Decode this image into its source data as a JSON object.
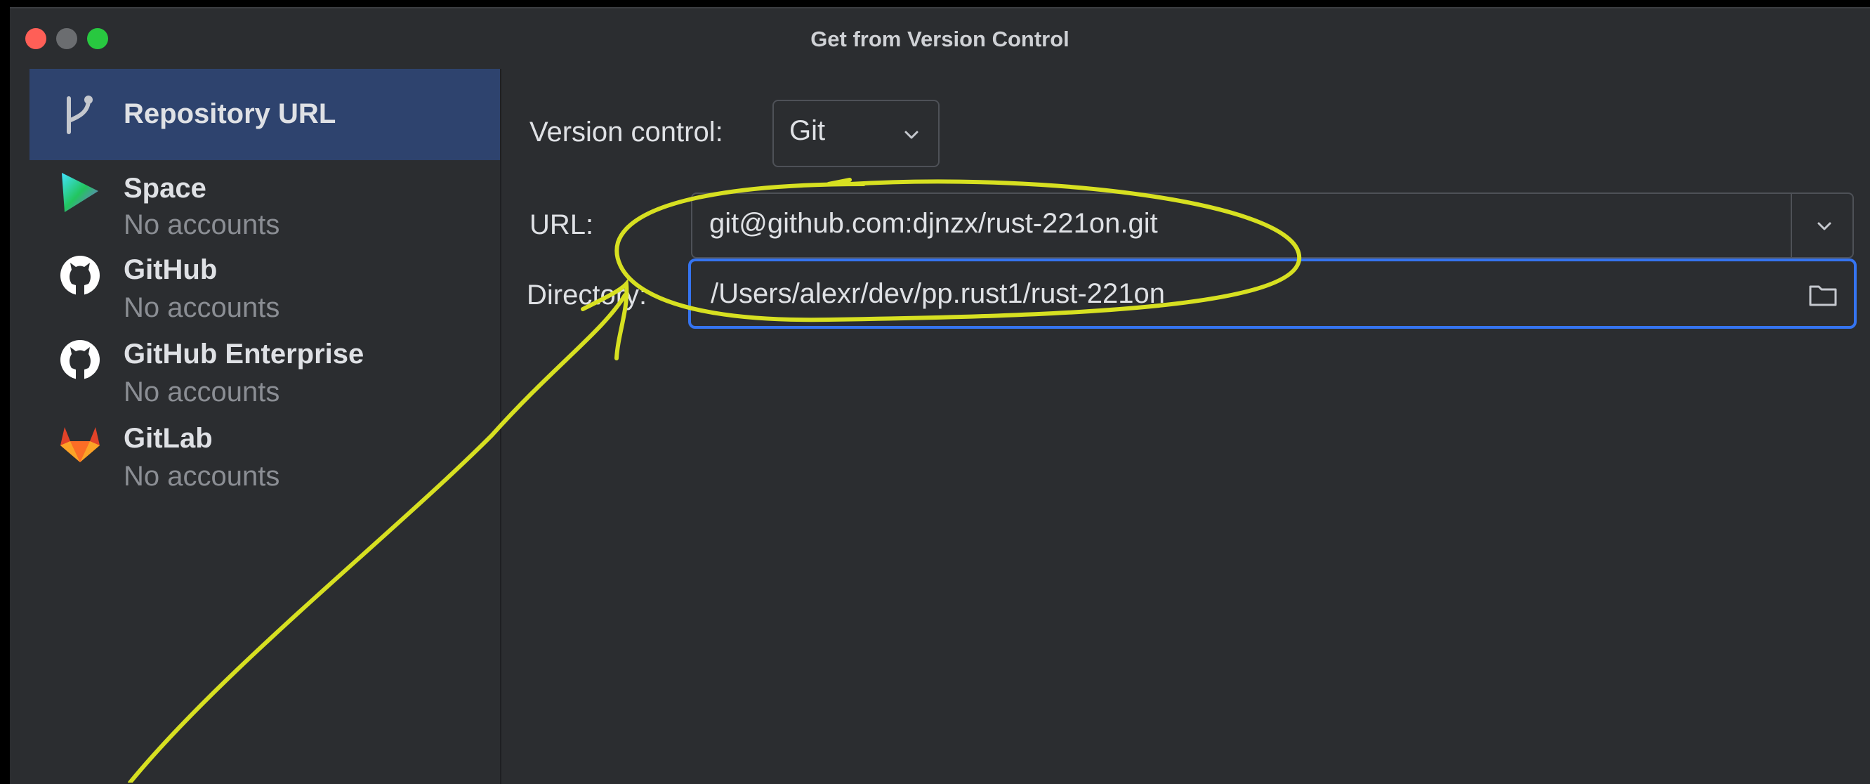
{
  "window": {
    "title": "Get from Version Control",
    "traffic_colors": [
      "#ff5f57",
      "#6b6d70",
      "#28c840"
    ]
  },
  "sidebar": {
    "items": [
      {
        "name": "Repository URL",
        "sub": "",
        "icon": "vcs-branch-icon",
        "selected": true
      },
      {
        "name": "Space",
        "sub": "No accounts",
        "icon": "space-logo-icon",
        "selected": false
      },
      {
        "name": "GitHub",
        "sub": "No accounts",
        "icon": "github-logo-icon",
        "selected": false
      },
      {
        "name": "GitHub Enterprise",
        "sub": "No accounts",
        "icon": "github-logo-icon",
        "selected": false
      },
      {
        "name": "GitLab",
        "sub": "No accounts",
        "icon": "gitlab-logo-icon",
        "selected": false
      }
    ]
  },
  "form": {
    "version_control_label": "Version control:",
    "version_control_value": "Git",
    "url_label": "URL:",
    "url_value": "git@github.com:djnzx/rust-221on.git",
    "directory_label": "Directory:",
    "directory_value": "/Users/alexr/dev/pp.rust1/rust-221on"
  },
  "colors": {
    "accent": "#3574f0",
    "annotation": "#d7e021",
    "selection": "#2e436e"
  }
}
